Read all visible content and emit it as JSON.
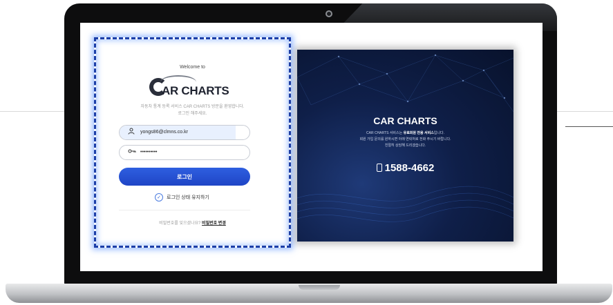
{
  "login": {
    "welcome": "Welcome to",
    "logo_text": "AR CHARTS",
    "description_line1": "자동차 통계 등록 서비스 CAR CHARTS 방문을 환영합니다.",
    "description_line2": "로그인 해주세요.",
    "email_value": "yongs86@clmns.co.kr",
    "password_value": "••••••••••",
    "login_button": "로그인",
    "remember_label": "로그인 상태 유지하기",
    "forgot_prefix": "비밀번호를 잊으셨나요?",
    "forgot_link": "비밀번호 변경"
  },
  "info": {
    "title": "CAR CHARTS",
    "line1_prefix": "CAR CHARTS 서비스는 ",
    "line1_bold": "유료회원 전용 서비스",
    "line1_suffix": "입니다.",
    "line2": "회원 가입 문의를 원하시면 아래 연락처로 전화 주시기 바랍니다.",
    "line3": "친절히 상담해 드리겠습니다.",
    "phone": "1588-4662"
  },
  "icons": {
    "user": "user-icon",
    "key": "key-icon",
    "check": "check-icon",
    "phone": "phone-icon"
  },
  "colors": {
    "primary": "#2548d0",
    "panel_dark": "#0f1f49"
  }
}
